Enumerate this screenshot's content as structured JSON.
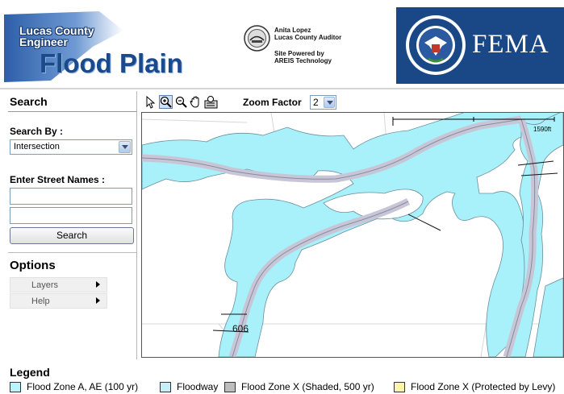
{
  "header": {
    "logo": {
      "line1": "Lucas County",
      "line2": "Engineer",
      "line3": "Flood Plain"
    },
    "auditor": {
      "name": "Anita Lopez",
      "title": "Lucas County Auditor",
      "powered_line1": "Site Powered by",
      "powered_line2": "AREIS Technology"
    },
    "fema": {
      "text": "FEMA"
    }
  },
  "sidebar": {
    "search_title": "Search",
    "search_by_label": "Search By :",
    "search_by_value": "Intersection",
    "street_names_label": "Enter Street Names :",
    "street1_value": "",
    "street2_value": "",
    "search_button": "Search",
    "options_title": "Options",
    "options": [
      {
        "label": "Layers"
      },
      {
        "label": "Help"
      }
    ]
  },
  "toolbar": {
    "zoom_label": "Zoom Factor",
    "zoom_value": "2",
    "tools": [
      "pointer-icon",
      "zoom-in-icon",
      "zoom-out-icon",
      "pan-icon",
      "identify-icon"
    ]
  },
  "map": {
    "scale_text": "1590ft",
    "road_label": "606",
    "colors": {
      "flood": "#a8f0fa",
      "floodway": "#c6c6d6",
      "outline": "#7fa0b0"
    }
  },
  "legend": {
    "title": "Legend",
    "items": [
      {
        "label": "Flood Zone A, AE (100 yr)",
        "color": "#b7f5fb"
      },
      {
        "label": "Floodway",
        "color": "#c8eef7"
      },
      {
        "label": "Flood Zone X (Shaded, 500 yr)",
        "color": "#bdbdbd"
      },
      {
        "label": "Flood Zone X (Protected by Levy)",
        "color": "#fcf3ac"
      }
    ]
  }
}
